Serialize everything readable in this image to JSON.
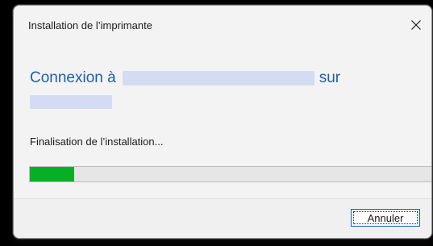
{
  "window": {
    "title": "Installation de l’imprimante",
    "close_icon": "close-icon"
  },
  "heading": {
    "prefix": "Connexion à",
    "suffix": "sur"
  },
  "status": {
    "text": "Finalisation de l’installation..."
  },
  "progress": {
    "value_percent": 11,
    "fill_color": "#06b025"
  },
  "footer": {
    "cancel_label": "Annuler"
  },
  "colors": {
    "heading": "#1f5fb4",
    "redaction": "#d4dcf4"
  }
}
